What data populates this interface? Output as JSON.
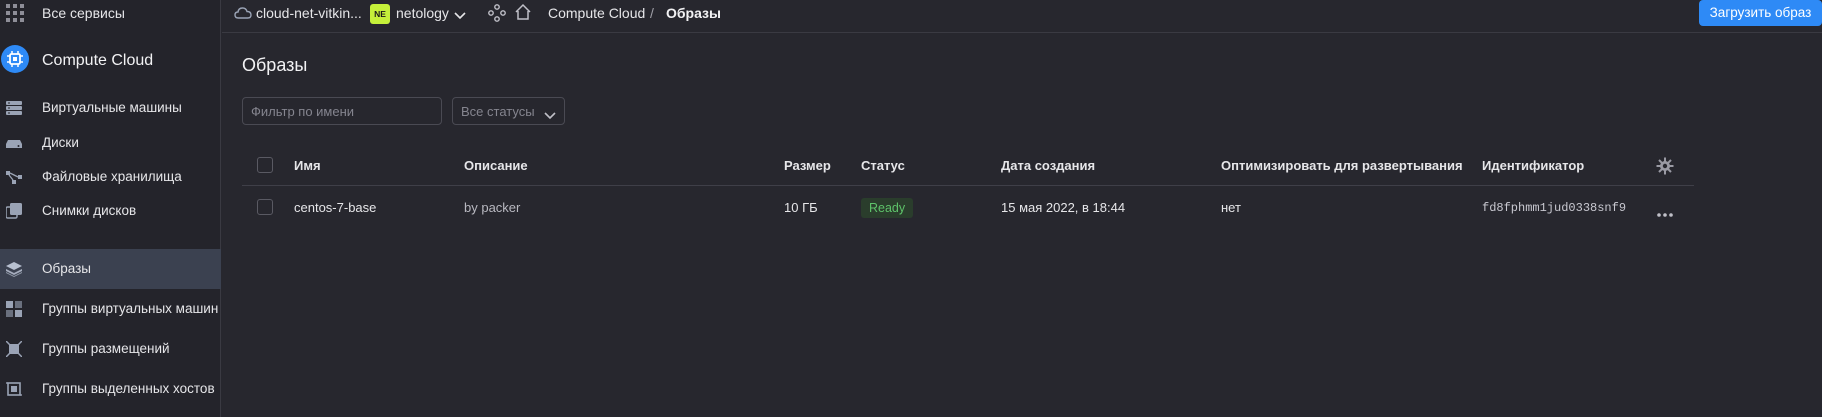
{
  "top": {
    "all_services_label": "Все сервисы"
  },
  "service": {
    "title": "Compute Cloud"
  },
  "sidebar": {
    "items": [
      {
        "label": "Виртуальные машины",
        "icon": "servers-icon"
      },
      {
        "label": "Диски",
        "icon": "disk-icon"
      },
      {
        "label": "Файловые хранилища",
        "icon": "file-storage-icon"
      },
      {
        "label": "Снимки дисков",
        "icon": "snapshots-icon"
      },
      {
        "label": "Образы",
        "icon": "layers-icon",
        "active": true
      },
      {
        "label": "Группы виртуальных машин",
        "icon": "instance-groups-icon"
      },
      {
        "label": "Группы размещений",
        "icon": "placement-groups-icon"
      },
      {
        "label": "Группы выделенных хостов",
        "icon": "host-groups-icon"
      }
    ]
  },
  "header": {
    "cloud_label": "cloud-net-vitkin...",
    "folder_badge": "NE",
    "folder_label": "netology",
    "breadcrumb": {
      "service": "Compute Cloud",
      "separator": "/",
      "current": "Образы"
    },
    "upload_button": "Загрузить образ"
  },
  "main": {
    "title": "Образы",
    "filter_placeholder": "Фильтр по имени",
    "status_select": "Все статусы"
  },
  "table": {
    "headers": {
      "name": "Имя",
      "description": "Описание",
      "size": "Размер",
      "status": "Статус",
      "created": "Дата создания",
      "optimize": "Оптимизировать для развертывания",
      "id": "Идентификатор"
    },
    "rows": [
      {
        "name": "centos-7-base",
        "description": "by packer",
        "size": "10 ГБ",
        "status": "Ready",
        "created": "15 мая 2022, в 18:44",
        "optimize": "нет",
        "id": "fd8fphmm1jud0338snf9"
      }
    ]
  },
  "colors": {
    "accent": "#2e8af6",
    "status_ready": "#5ec26a",
    "badge": "#c5f03a",
    "active_nav": "#3b4150"
  }
}
